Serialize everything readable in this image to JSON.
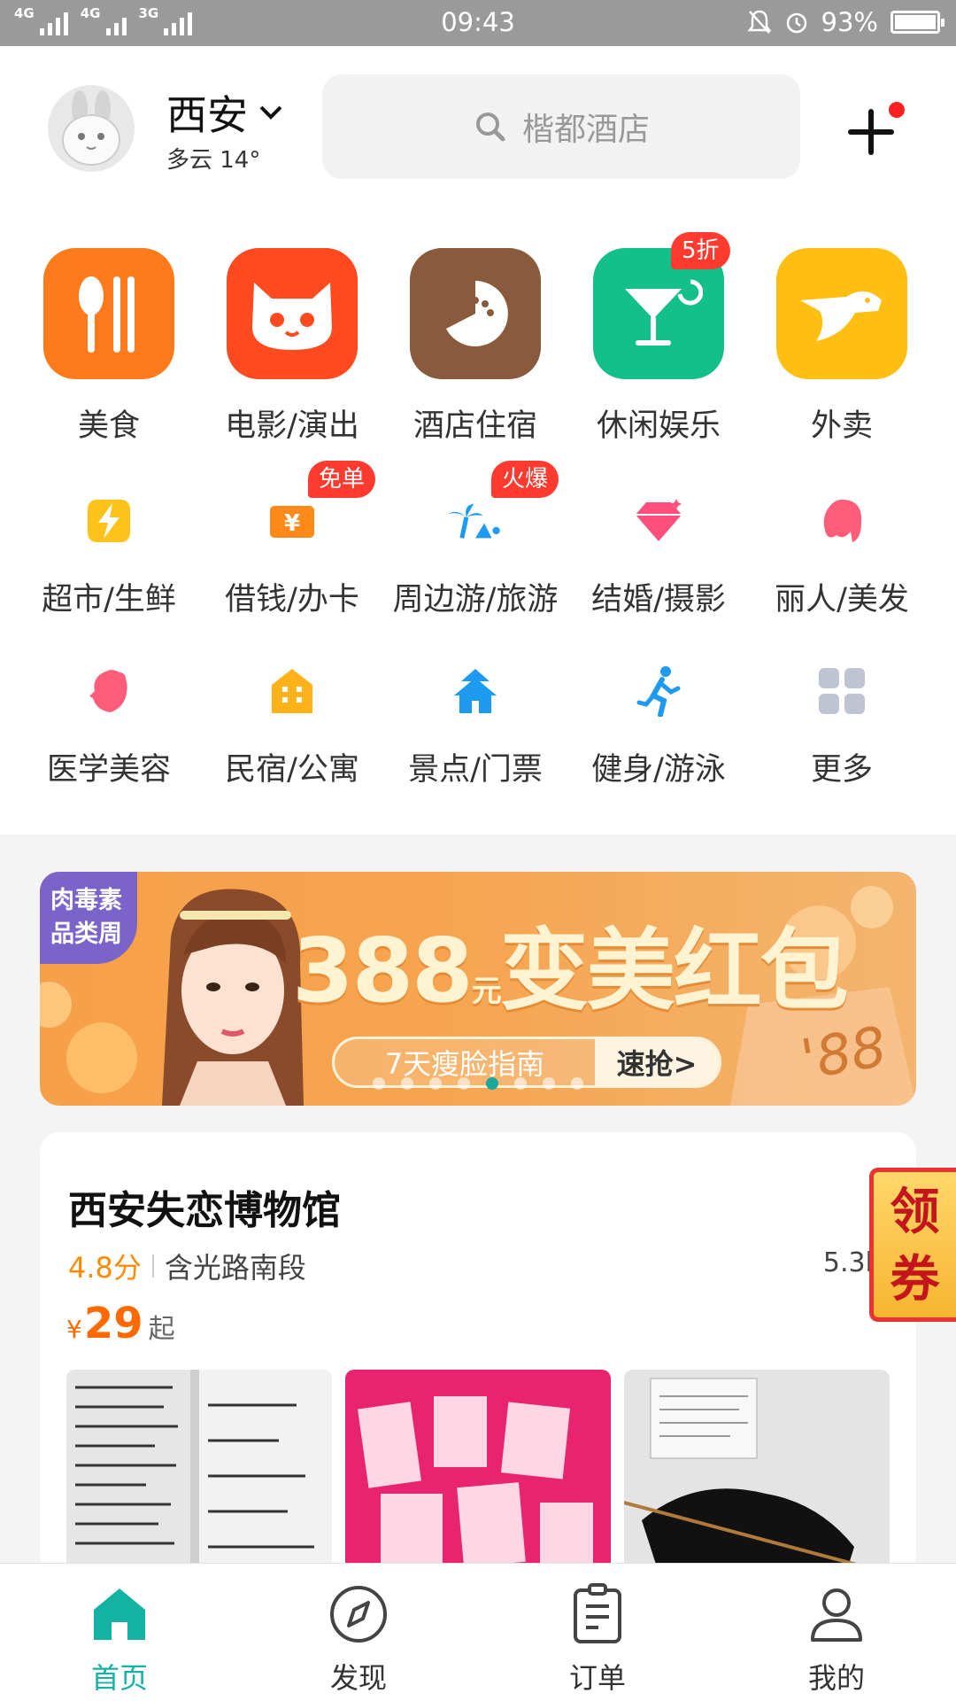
{
  "status_bar": {
    "network_1": "4G",
    "network_2": "4G",
    "network_3": "3G",
    "time": "09:43",
    "battery": "93%"
  },
  "header": {
    "city": "西安",
    "weather": "多云 14°",
    "search_placeholder": "楷都酒店"
  },
  "main_categories": [
    {
      "label": "美食",
      "icon": "fork-spoon-icon",
      "color": "#ff7a1a"
    },
    {
      "label": "电影/演出",
      "icon": "cat-face-icon",
      "color": "#ff4a1f"
    },
    {
      "label": "酒店住宿",
      "icon": "hotel-icon",
      "color": "#8a5a3c"
    },
    {
      "label": "休闲娱乐",
      "icon": "cocktail-icon",
      "color": "#14c08a",
      "badge": "5折"
    },
    {
      "label": "外卖",
      "icon": "kangaroo-icon",
      "color": "#ffbe12"
    }
  ],
  "sub_categories": [
    {
      "label": "超市/生鲜",
      "icon": "lightning-icon"
    },
    {
      "label": "借钱/办卡",
      "icon": "yuan-card-icon",
      "badge": "免单"
    },
    {
      "label": "周边游/旅游",
      "icon": "palm-tree-icon",
      "badge": "火爆"
    },
    {
      "label": "结婚/摄影",
      "icon": "diamond-icon"
    },
    {
      "label": "丽人/美发",
      "icon": "hair-icon"
    },
    {
      "label": "医学美容",
      "icon": "face-icon"
    },
    {
      "label": "民宿/公寓",
      "icon": "house-icon"
    },
    {
      "label": "景点/门票",
      "icon": "pagoda-icon"
    },
    {
      "label": "健身/游泳",
      "icon": "runner-icon"
    },
    {
      "label": "更多",
      "icon": "grid-icon"
    }
  ],
  "banner": {
    "tag": "肉毒素品类周",
    "amount": "388",
    "unit": "元",
    "title": "变美红包",
    "pill_text": "7天瘦脸指南",
    "pill_action": "速抢>",
    "decor": "'88",
    "total_dots": 8,
    "active_dot": 4
  },
  "card": {
    "title": "西安失恋博物馆",
    "score": "4.8分",
    "address": "含光路南段",
    "distance": "5.3k",
    "currency": "¥",
    "price": "29",
    "price_suffix": "起"
  },
  "coupon": {
    "line1": "领",
    "line2": "券"
  },
  "tabbar": [
    {
      "label": "首页",
      "icon": "home-icon",
      "active": true
    },
    {
      "label": "发现",
      "icon": "compass-icon",
      "active": false
    },
    {
      "label": "订单",
      "icon": "order-icon",
      "active": false
    },
    {
      "label": "我的",
      "icon": "profile-icon",
      "active": false
    }
  ]
}
